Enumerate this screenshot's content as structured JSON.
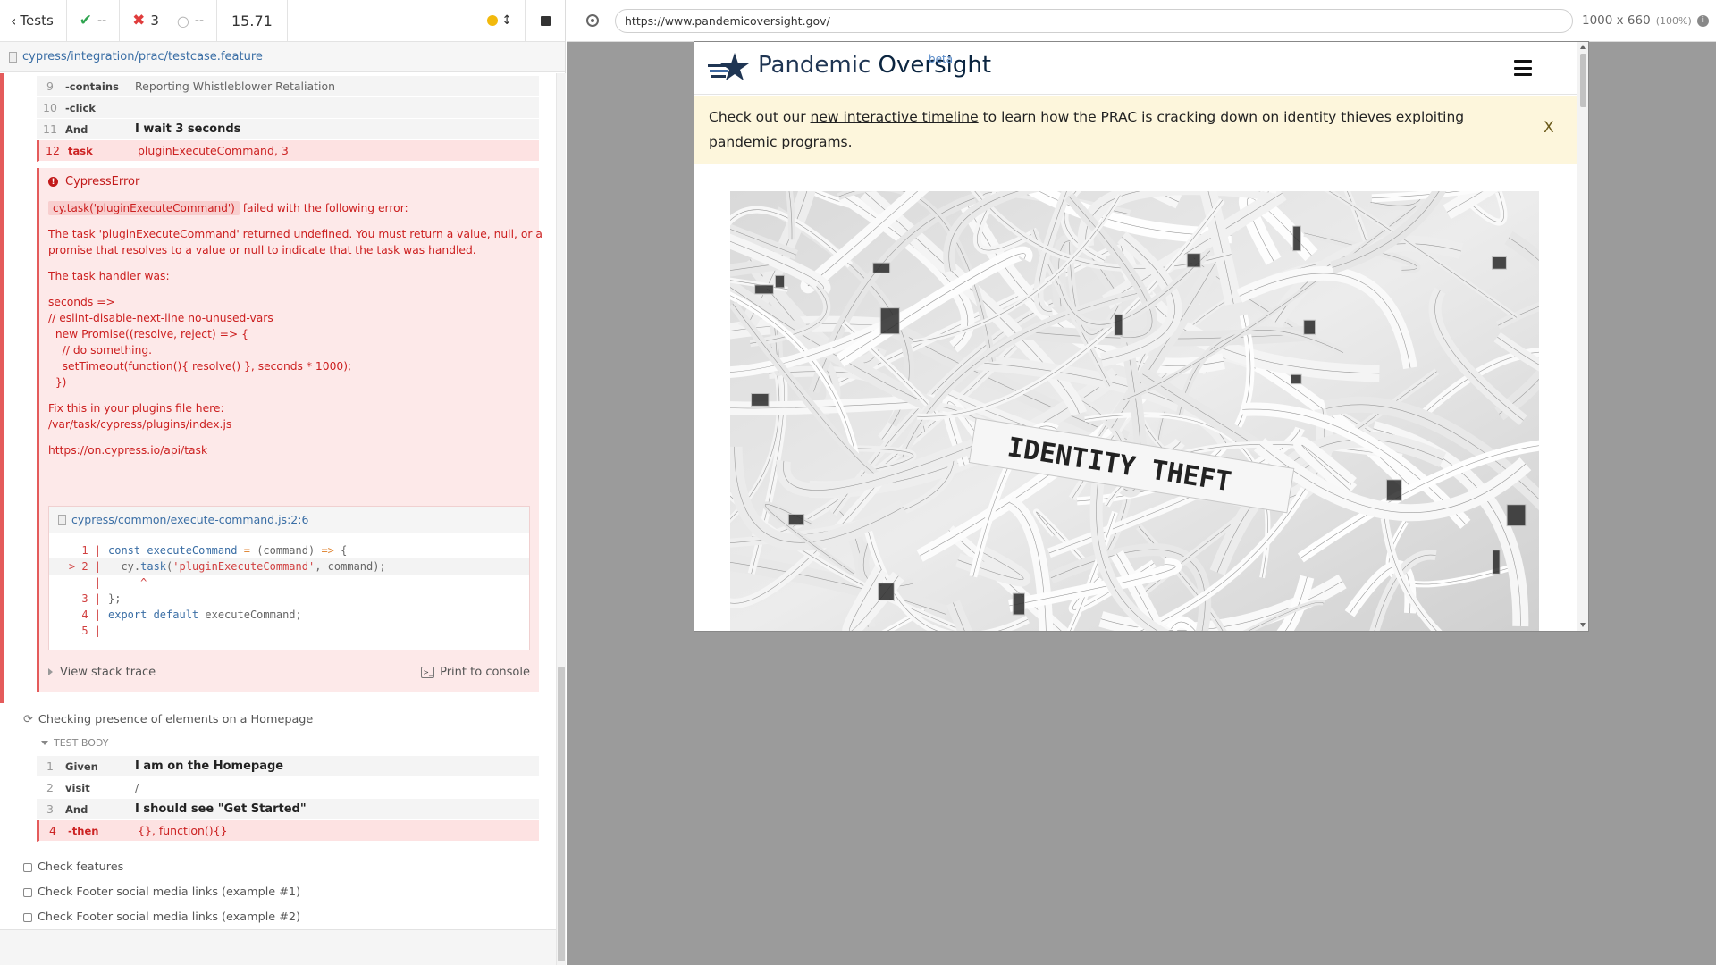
{
  "header": {
    "tests_label": "Tests",
    "passed": "--",
    "failed": "3",
    "pending": "--",
    "duration": "15.71"
  },
  "spec": {
    "path": "cypress/integration/prac/testcase.feature"
  },
  "commands_top": [
    {
      "num": "9",
      "kw": "-contains",
      "msg": "Reporting Whistleblower Retaliation",
      "strong": false,
      "state": "normal"
    },
    {
      "num": "10",
      "kw": "-click",
      "msg": "",
      "strong": false,
      "state": "normal"
    },
    {
      "num": "11",
      "kw": "And",
      "msg": "I wait 3 seconds",
      "strong": true,
      "state": "normal"
    },
    {
      "num": "12",
      "kw": "task",
      "msg": "pluginExecuteCommand, 3",
      "strong": false,
      "state": "error"
    }
  ],
  "error": {
    "name": "CypressError",
    "code_ref": "cy.task('pluginExecuteCommand')",
    "headline_rest": " failed with the following error:",
    "line1": "The task 'pluginExecuteCommand' returned undefined. You must return a value, null, or a",
    "line2": "promise that resolves to a value or null to indicate that the task was handled.",
    "handler_label": "The task handler was:",
    "handler_code": [
      "seconds =>",
      "// eslint-disable-next-line no-unused-vars",
      "  new Promise((resolve, reject) => {",
      "    // do something.",
      "    setTimeout(function(){ resolve() }, seconds * 1000);",
      "  })"
    ],
    "fix_label": "Fix this in your plugins file here:",
    "fix_path": "/var/task/cypress/plugins/index.js",
    "docs_url": "https://on.cypress.io/api/task",
    "codeframe_file": "cypress/common/execute-command.js:2:6",
    "stack_trace_label": "View stack trace",
    "print_label": "Print to console"
  },
  "code_lines": [
    {
      "gut": "  1 |",
      "parts": [
        [
          "const ",
          "k-blue"
        ],
        [
          "executeCommand ",
          "k-blue"
        ],
        [
          "= ",
          "k-orange"
        ],
        [
          "(command) ",
          "k-grey"
        ],
        [
          "=> ",
          "k-orange"
        ],
        [
          "{",
          "k-grey"
        ]
      ]
    },
    {
      "gut": "> 2 |",
      "parts": [
        [
          "  cy.",
          "k-grey"
        ],
        [
          "task",
          "k-blue"
        ],
        [
          "(",
          "k-grey"
        ],
        [
          "'pluginExecuteCommand'",
          "k-red"
        ],
        [
          ", command);",
          "k-grey"
        ]
      ]
    },
    {
      "gut": "    |",
      "parts": [
        [
          "     ^",
          "k-red"
        ]
      ]
    },
    {
      "gut": "  3 |",
      "parts": [
        [
          "};",
          "k-grey"
        ]
      ]
    },
    {
      "gut": "  4 |",
      "parts": [
        [
          "export ",
          "k-blue"
        ],
        [
          "default ",
          "k-blue"
        ],
        [
          "executeCommand;",
          "k-grey"
        ]
      ]
    },
    {
      "gut": "  5 |",
      "parts": [
        [
          "",
          "k-grey"
        ]
      ]
    }
  ],
  "test2": {
    "title": "Checking presence of elements on a Homepage",
    "body_label": "TEST BODY",
    "commands": [
      {
        "num": "1",
        "kw": "Given",
        "msg": "I am on the Homepage",
        "strong": true,
        "state": "normal"
      },
      {
        "num": "2",
        "kw": "visit",
        "msg": "/",
        "strong": false,
        "state": "white"
      },
      {
        "num": "3",
        "kw": "And",
        "msg": "I should see \"Get Started\"",
        "strong": true,
        "state": "normal"
      },
      {
        "num": "4",
        "kw": "-then",
        "msg": "{}, function(){}",
        "strong": false,
        "state": "error"
      }
    ]
  },
  "pending_tests": [
    "Check features",
    "Check Footer social media links (example #1)",
    "Check Footer social media links (example #2)"
  ],
  "aut": {
    "url": "https://www.pandemicoversight.gov/",
    "viewport": "1000 x 660",
    "zoom": "(100%)"
  },
  "site": {
    "brand_part1": "Pandemic ",
    "brand_part2": "Oversight",
    "beta": "beta",
    "banner_pre": "Check out our ",
    "banner_link": "new interactive timeline",
    "banner_post": " to learn how the PRAC is cracking down on identity thieves exploiting pandemic programs.",
    "banner_close": "X",
    "hero_text": "IDENTITY THEFT"
  },
  "colors": {
    "fail_red": "#e45b5b",
    "pass_green": "#2ea44f",
    "link_blue": "#3a6ea5",
    "banner_bg": "#fdf6dc"
  }
}
